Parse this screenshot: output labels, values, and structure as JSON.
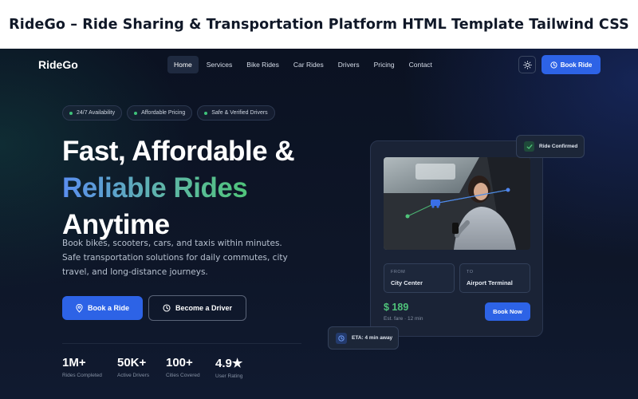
{
  "banner": {
    "title": "RideGo – Ride Sharing & Transportation Platform HTML Template Tailwind CSS"
  },
  "nav": {
    "logo": "RideGo",
    "links": [
      "Home",
      "Services",
      "Bike Rides",
      "Car Rides",
      "Drivers",
      "Pricing",
      "Contact"
    ],
    "active_index": 0,
    "book_button": "Book Ride"
  },
  "badges": [
    "24/7 Availability",
    "Affordable Pricing",
    "Safe & Verified Drivers"
  ],
  "hero": {
    "line1": "Fast, Affordable &",
    "line2": "Reliable Rides",
    "line3": "Anytime",
    "description": "Book bikes, scooters, cars, and taxis within minutes. Safe transportation solutions for daily commutes, city travel, and long-distance journeys.",
    "primary_cta": "Book a Ride",
    "secondary_cta": "Become a Driver"
  },
  "stats": [
    {
      "value": "1M+",
      "label": "Rides Completed"
    },
    {
      "value": "50K+",
      "label": "Active Drivers"
    },
    {
      "value": "100+",
      "label": "Cities Covered"
    },
    {
      "value": "4.9★",
      "label": "User Rating"
    }
  ],
  "ride_card": {
    "from_label": "FROM",
    "from_value": "City Center",
    "to_label": "TO",
    "to_value": "Airport Terminal",
    "price": "$ 189",
    "fare_note": "Est. fare · 12 min",
    "book_now": "Book Now",
    "confirmed": "Ride Confirmed",
    "eta": "ETA: 4 min away"
  },
  "colors": {
    "accent": "#2d63e6",
    "success": "#4fc47a",
    "background": "#0e1628"
  }
}
